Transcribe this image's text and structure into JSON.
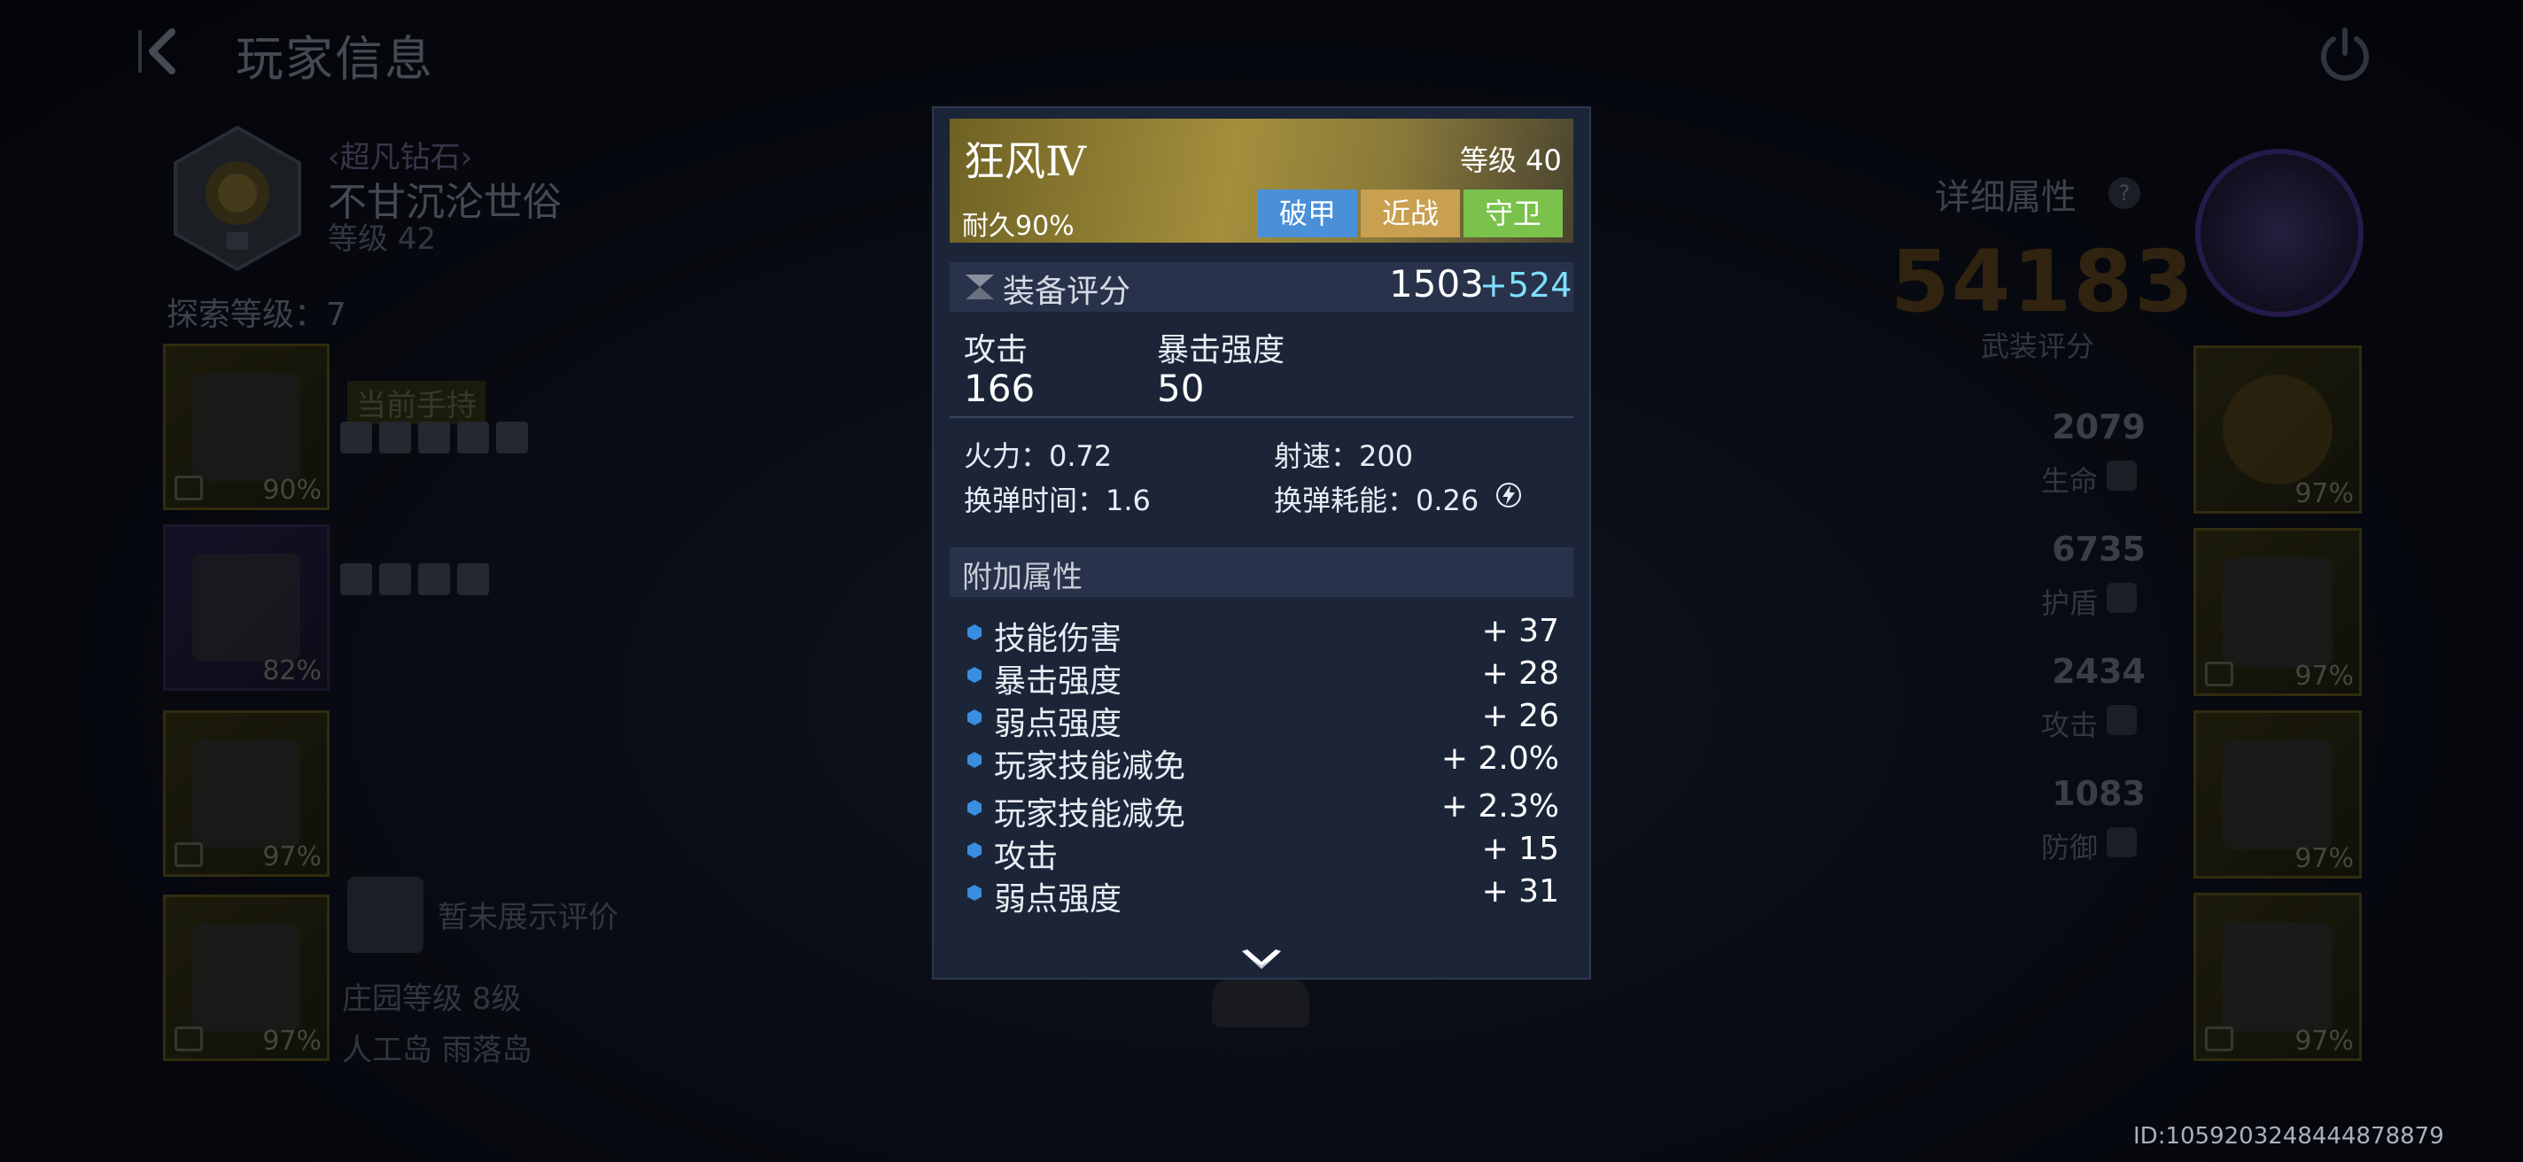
{
  "header": {
    "title": "玩家信息"
  },
  "player": {
    "rank": "‹超凡钻石›",
    "name": "不甘沉沦世俗",
    "level": "等级 42",
    "explore": "探索等级：7"
  },
  "loadout": {
    "holding_label": "当前手持",
    "slots": [
      {
        "pct": "90%"
      },
      {
        "pct": "82%"
      },
      {
        "pct": "97%"
      },
      {
        "pct": "97%"
      }
    ]
  },
  "social": {
    "evaluation": "暂未展示评价",
    "estate": "庄园等级 8级",
    "island": "人工岛 雨落岛"
  },
  "summary": {
    "detail_title": "详细属性",
    "help": "?",
    "power_score": "54183",
    "power_label": "武装评分",
    "stats": [
      {
        "value": "2079",
        "label": "生命"
      },
      {
        "value": "6735",
        "label": "护盾"
      },
      {
        "value": "2434",
        "label": "攻击"
      },
      {
        "value": "1083",
        "label": "防御"
      }
    ],
    "armor_slots": [
      {
        "pct": "97%"
      },
      {
        "pct": "97%"
      },
      {
        "pct": "97%"
      },
      {
        "pct": "97%"
      }
    ]
  },
  "uid": "ID:1059203248444878879",
  "item": {
    "name": "狂风Ⅳ",
    "level": "等级 40",
    "durability": "耐久90%",
    "tags": [
      "破甲",
      "近战",
      "守卫"
    ],
    "score_label": "装备评分",
    "score": "1503",
    "score_bonus": "+524",
    "primary": [
      {
        "label": "攻击",
        "value": "166"
      },
      {
        "label": "暴击强度",
        "value": "50"
      }
    ],
    "stats": {
      "firepower": "火力：0.72",
      "fire_rate": "射速：200",
      "reload": "换弹时间：1.6",
      "reload_cost": "换弹耗能：0.26"
    },
    "extra_title": "附加属性",
    "bonuses": [
      {
        "name": "技能伤害",
        "value": "+ 37"
      },
      {
        "name": "暴击强度",
        "value": "+ 28"
      },
      {
        "name": "弱点强度",
        "value": "+ 26"
      },
      {
        "name": "玩家技能减免",
        "value": "+ 2.0%"
      },
      {
        "name": "玩家技能减免",
        "value": "+ 2.3%"
      },
      {
        "name": "攻击",
        "value": "+ 15"
      },
      {
        "name": "弱点强度",
        "value": "+ 31"
      }
    ]
  },
  "colors": {
    "tag_blue": "#4a90d8",
    "tag_gold": "#c8a050",
    "tag_green": "#7ac24c",
    "bonus_cyan": "#7ee0ff",
    "bullet": "#3a8ee0"
  }
}
